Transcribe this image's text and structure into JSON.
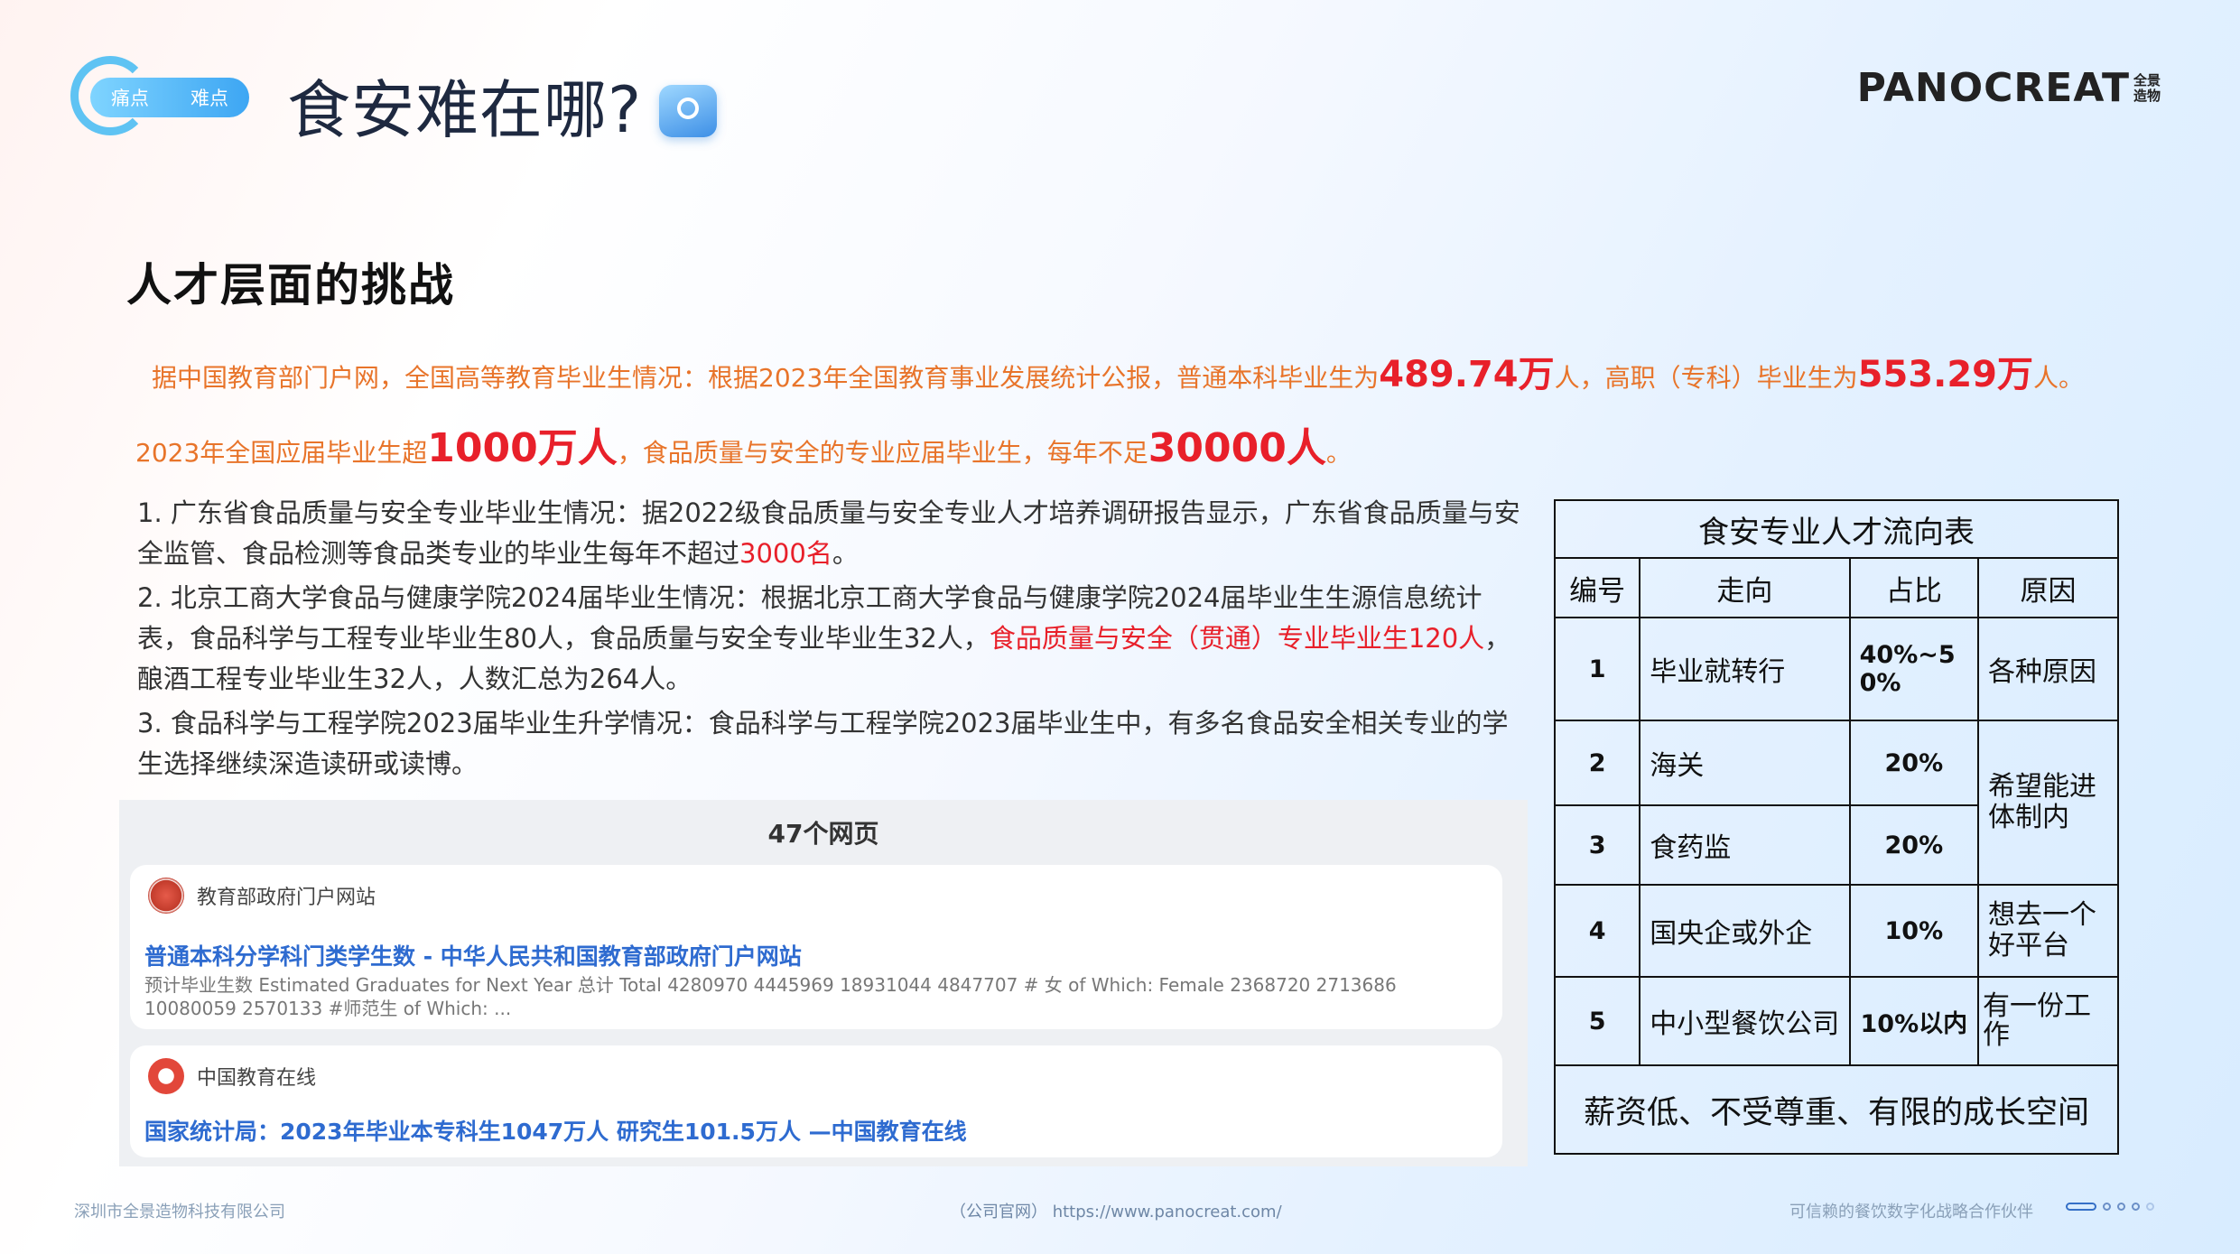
{
  "header": {
    "badge_left": "痛点",
    "badge_right": "难点",
    "title": "食安难在哪?",
    "logo_main": "PANOCREAT",
    "logo_sub": "全景造物"
  },
  "section_heading": "人才层面的挑战",
  "summary": {
    "line1_a": "据中国教育部门户网，全国高等教育毕业生情况：根据2023年全国教育事业发展统计公报，普通本科毕业生为",
    "line1_b": "489.74万",
    "line1_c": "人，高职（专科）毕业生为",
    "line1_d": "553.29万",
    "line1_e": "人。",
    "line2_a": "2023年全国应届毕业生超",
    "line2_b": "1000万人",
    "line2_c": "，食品质量与安全的专业应届毕业生，每年不足",
    "line2_d": "30000人",
    "line2_e": "。"
  },
  "points": {
    "p1_a": "1. 广东省食品质量与安全专业毕业生情况：据2022级食品质量与安全专业人才培养调研报告显示，广东省食品质量与安全监管、食品检测等食品类专业的毕业生每年不超过",
    "p1_b": "3000名",
    "p1_c": "。",
    "p2_a": "2. 北京工商大学食品与健康学院2024届毕业生情况：根据北京工商大学食品与健康学院2024届毕业生生源信息统计表，食品科学与工程专业毕业生80人，食品质量与安全专业毕业生32人，",
    "p2_b": "食品质量与安全（贯通）专业毕业生120人",
    "p2_c": "，酿酒工程专业毕业生32人，人数汇总为264人。",
    "p3": "3. 食品科学与工程学院2023届毕业生升学情况：食品科学与工程学院2023届毕业生中，有多名食品安全相关专业的学生选择继续深造读研或读博。"
  },
  "web": {
    "header": "47个网页",
    "r1_source": "教育部政府门户网站",
    "r1_title": "普通本科分学科门类学生数 - 中华人民共和国教育部政府门户网站",
    "r1_snippet": "预计毕业生数 Estimated Graduates for Next Year 总计 Total 4280970 4445969 18931044 4847707 # 女 of Which: Female 2368720 2713686 10080059 2570133 #师范生 of Which: ...",
    "r2_source": "中国教育在线",
    "r2_title": "国家统计局：2023年毕业本专科生1047万人 研究生101.5万人 —中国教育在线"
  },
  "table": {
    "caption": "食安专业人才流向表",
    "headers": [
      "编号",
      "走向",
      "占比",
      "原因"
    ],
    "rows": [
      {
        "no": "1",
        "dir": "毕业就转行",
        "pct": "40%~50%",
        "reason": "各种原因"
      },
      {
        "no": "2",
        "dir": "海关",
        "pct": "20%",
        "reason": "希望能进体制内"
      },
      {
        "no": "3",
        "dir": "食药监",
        "pct": "20%",
        "reason": ""
      },
      {
        "no": "4",
        "dir": "国央企或外企",
        "pct": "10%",
        "reason": "想去一个好平台"
      },
      {
        "no": "5",
        "dir": "中小型餐饮公司",
        "pct": "10%以内",
        "reason": "有一份工作"
      }
    ],
    "footer": "薪资低、不受尊重、有限的成长空间"
  },
  "footer": {
    "company": "深圳市全景造物科技有限公司",
    "site": "（公司官网）  https://www.panocreat.com/",
    "slogan": "可信赖的餐饮数字化战略合作伙伴"
  },
  "colors": {
    "accent_orange": "#e8742a",
    "accent_red": "#e8202a",
    "brand_blue": "#3da6f3"
  }
}
